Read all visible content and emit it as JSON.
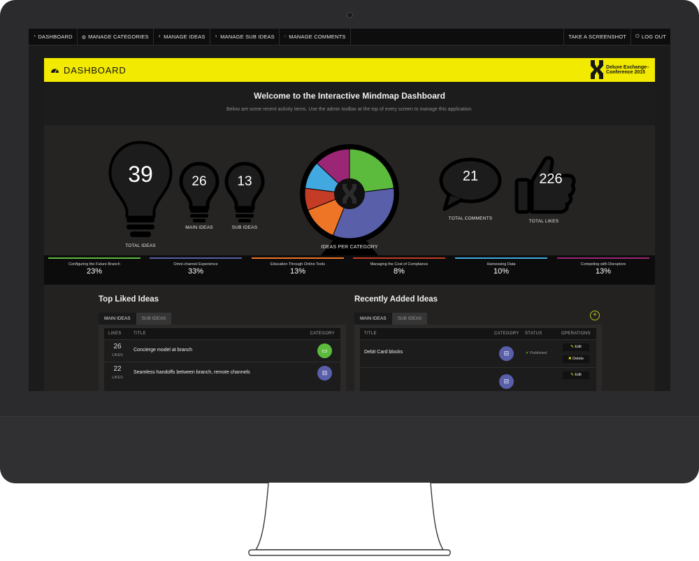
{
  "nav": {
    "items": [
      {
        "icon": "dashboard-icon",
        "label": "DASHBOARD"
      },
      {
        "icon": "globe-icon",
        "label": "MANAGE CATEGORIES"
      },
      {
        "icon": "bulb-icon",
        "label": "MANAGE IDEAS"
      },
      {
        "icon": "bulb-icon",
        "label": "MANAGE SUB IDEAS"
      },
      {
        "icon": "comment-icon",
        "label": "MANAGE COMMENTS"
      }
    ],
    "screenshot_label": "TAKE A SCREENSHOT",
    "logout_label": "LOG OUT"
  },
  "header": {
    "title": "DASHBOARD",
    "logo_line1": "Deluxe Exchange",
    "logo_line2": "Conference 2015",
    "logo_tm": "™"
  },
  "welcome": {
    "title": "Welcome to the Interactive Mindmap Dashboard",
    "subtitle": "Below are some recent activity items. Use the admin toolbar at the top of every screen to manage this application."
  },
  "stats": {
    "total_ideas": {
      "value": "39",
      "label": "TOTAL IDEAS"
    },
    "main_ideas": {
      "value": "26",
      "label": "MAIN IDEAS"
    },
    "sub_ideas": {
      "value": "13",
      "label": "SUB IDEAS"
    },
    "ideas_per_category_label": "IDEAS PER CATEGORY",
    "total_comments": {
      "value": "21",
      "label": "TOTAL COMMENTS"
    },
    "total_likes": {
      "value": "226",
      "label": "TOTAL LIKES"
    }
  },
  "chart_data": {
    "type": "pie",
    "title": "IDEAS PER CATEGORY",
    "categories": [
      "Configuring the Future Branch",
      "Omni-channel Experience",
      "Education Through Online Tools",
      "Managing the Cost of Compliance",
      "Harnessing Data",
      "Competing with Disruptors"
    ],
    "values": [
      23,
      33,
      13,
      8,
      10,
      13
    ],
    "colors": [
      "#5cbb3c",
      "#5a5faa",
      "#ee7526",
      "#c43b26",
      "#41a9e0",
      "#9b2676"
    ]
  },
  "categories": [
    {
      "name": "Configuring the Future Branch",
      "pct": "23%",
      "color": "#5cbb3c"
    },
    {
      "name": "Omni-channel Experience",
      "pct": "33%",
      "color": "#5a5faa"
    },
    {
      "name": "Education Through Online Tools",
      "pct": "13%",
      "color": "#ee7526"
    },
    {
      "name": "Managing the Cost of Compliance",
      "pct": "8%",
      "color": "#c43b26"
    },
    {
      "name": "Harnessing Data",
      "pct": "10%",
      "color": "#41a9e0"
    },
    {
      "name": "Competing with Disruptors",
      "pct": "13%",
      "color": "#9b2676"
    }
  ],
  "top_liked": {
    "title": "Top Liked Ideas",
    "tabs": [
      "MAIN IDEAS",
      "SUB IDEAS"
    ],
    "headers": {
      "likes": "LIKES",
      "title": "TITLE",
      "category": "CATEGORY"
    },
    "rows": [
      {
        "likes": "26",
        "likes_label": "LIKES",
        "title": "Concierge model at branch",
        "category_icon": "monitor-icon",
        "category_color": "#5cbb3c"
      },
      {
        "likes": "22",
        "likes_label": "LIKES",
        "title": "Seamless handoffs between branch, remote channels",
        "category_icon": "car-icon",
        "category_color": "#5a5faa"
      }
    ]
  },
  "recent": {
    "title": "Recently Added Ideas",
    "tabs": [
      "MAIN IDEAS",
      "SUB IDEAS"
    ],
    "headers": {
      "title": "TITLE",
      "category": "CATEGORY",
      "status": "STATUS",
      "operations": "OPERATIONS"
    },
    "rows": [
      {
        "title": "Debit Card blocks",
        "category_icon": "car-icon",
        "category_color": "#5a5faa",
        "status": "Published",
        "edit": "Edit",
        "delete": "Delete"
      },
      {
        "title": "",
        "category_icon": "car-icon",
        "category_color": "#5a5faa",
        "status": "",
        "edit": "Edit",
        "delete": ""
      }
    ]
  }
}
